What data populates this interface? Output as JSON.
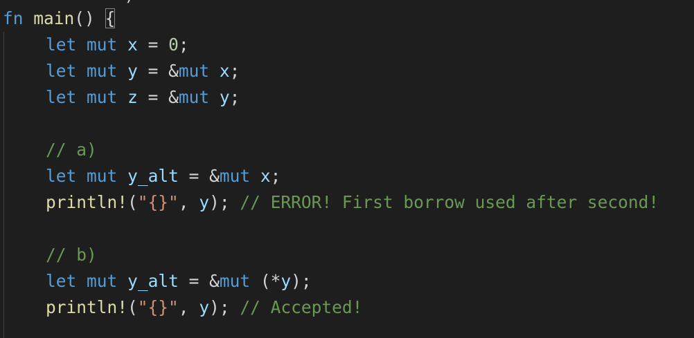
{
  "editor": {
    "top_fragment": "  ) ",
    "lines": [
      {
        "tokens": [
          {
            "t": "fn",
            "c": "kw"
          },
          {
            "t": " ",
            "c": "op"
          },
          {
            "t": "main",
            "c": "fn"
          },
          {
            "t": "() ",
            "c": "op"
          },
          {
            "t": "{",
            "c": "op",
            "m": true
          }
        ]
      },
      {
        "indent": true,
        "tokens": [
          {
            "t": "let",
            "c": "kw"
          },
          {
            "t": " ",
            "c": "op"
          },
          {
            "t": "mut",
            "c": "kw"
          },
          {
            "t": " ",
            "c": "op"
          },
          {
            "t": "x",
            "c": "var"
          },
          {
            "t": " = ",
            "c": "op"
          },
          {
            "t": "0",
            "c": "num"
          },
          {
            "t": ";",
            "c": "op"
          }
        ]
      },
      {
        "indent": true,
        "tokens": [
          {
            "t": "let",
            "c": "kw"
          },
          {
            "t": " ",
            "c": "op"
          },
          {
            "t": "mut",
            "c": "kw"
          },
          {
            "t": " ",
            "c": "op"
          },
          {
            "t": "y",
            "c": "var"
          },
          {
            "t": " = &",
            "c": "op"
          },
          {
            "t": "mut",
            "c": "kw"
          },
          {
            "t": " ",
            "c": "op"
          },
          {
            "t": "x",
            "c": "var"
          },
          {
            "t": ";",
            "c": "op"
          }
        ]
      },
      {
        "indent": true,
        "tokens": [
          {
            "t": "let",
            "c": "kw"
          },
          {
            "t": " ",
            "c": "op"
          },
          {
            "t": "mut",
            "c": "kw"
          },
          {
            "t": " ",
            "c": "op"
          },
          {
            "t": "z",
            "c": "var"
          },
          {
            "t": " = &",
            "c": "op"
          },
          {
            "t": "mut",
            "c": "kw"
          },
          {
            "t": " ",
            "c": "op"
          },
          {
            "t": "y",
            "c": "var"
          },
          {
            "t": ";",
            "c": "op"
          }
        ]
      },
      {
        "tokens": []
      },
      {
        "indent": true,
        "tokens": [
          {
            "t": "// a)",
            "c": "cmt"
          }
        ]
      },
      {
        "indent": true,
        "tokens": [
          {
            "t": "let",
            "c": "kw"
          },
          {
            "t": " ",
            "c": "op"
          },
          {
            "t": "mut",
            "c": "kw"
          },
          {
            "t": " ",
            "c": "op"
          },
          {
            "t": "y_alt",
            "c": "var"
          },
          {
            "t": " = &",
            "c": "op"
          },
          {
            "t": "mut",
            "c": "kw"
          },
          {
            "t": " ",
            "c": "op"
          },
          {
            "t": "x",
            "c": "var"
          },
          {
            "t": ";",
            "c": "op"
          }
        ]
      },
      {
        "indent": true,
        "tokens": [
          {
            "t": "println!",
            "c": "fn"
          },
          {
            "t": "(",
            "c": "op"
          },
          {
            "t": "\"{}\"",
            "c": "str"
          },
          {
            "t": ", ",
            "c": "op"
          },
          {
            "t": "y",
            "c": "var"
          },
          {
            "t": "); ",
            "c": "op"
          },
          {
            "t": "// ERROR! First borrow used after second!",
            "c": "cmt"
          }
        ]
      },
      {
        "tokens": []
      },
      {
        "indent": true,
        "tokens": [
          {
            "t": "// b)",
            "c": "cmt"
          }
        ]
      },
      {
        "indent": true,
        "tokens": [
          {
            "t": "let",
            "c": "kw"
          },
          {
            "t": " ",
            "c": "op"
          },
          {
            "t": "mut",
            "c": "kw"
          },
          {
            "t": " ",
            "c": "op"
          },
          {
            "t": "y_alt",
            "c": "var"
          },
          {
            "t": " = &",
            "c": "op"
          },
          {
            "t": "mut",
            "c": "kw"
          },
          {
            "t": " (*",
            "c": "op"
          },
          {
            "t": "y",
            "c": "var"
          },
          {
            "t": ");",
            "c": "op"
          }
        ]
      },
      {
        "indent": true,
        "tokens": [
          {
            "t": "println!",
            "c": "fn"
          },
          {
            "t": "(",
            "c": "op"
          },
          {
            "t": "\"{}\"",
            "c": "str"
          },
          {
            "t": ", ",
            "c": "op"
          },
          {
            "t": "y",
            "c": "var"
          },
          {
            "t": "); ",
            "c": "op"
          },
          {
            "t": "// Accepted!",
            "c": "cmt"
          }
        ]
      }
    ]
  }
}
